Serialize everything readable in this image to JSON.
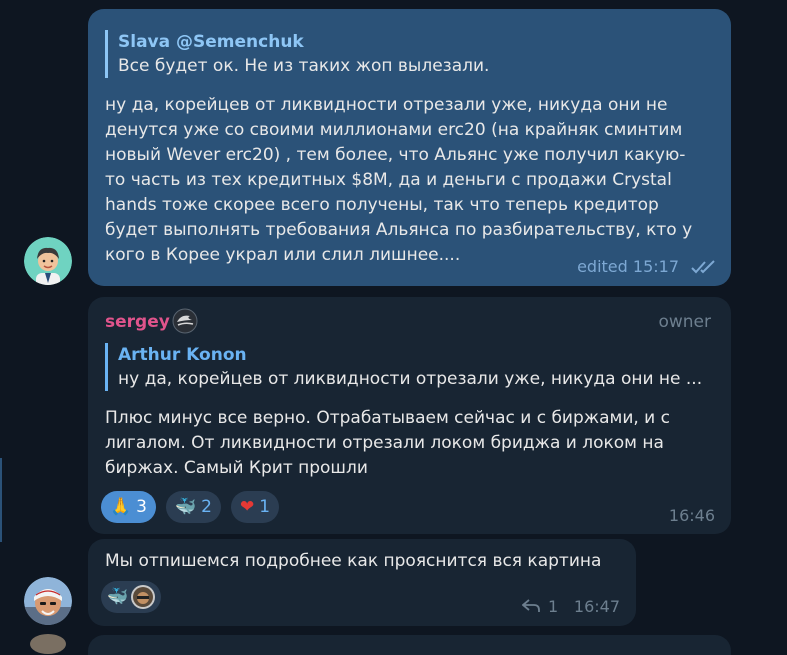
{
  "messages": [
    {
      "reply": {
        "author": "Slava @Semenchuk",
        "text": "Все будет ок. Не из таких жоп вылезали."
      },
      "lines": [
        "ну да, корейцев от ликвидности отрезали уже, никуда они не",
        "денутся уже со своими миллионами erc20 (на крайняк сминтим",
        "новый Wever erc20) , тем более, что Альянс уже получил какую-",
        "то часть из тех кредитных $8M, да и деньги   с продажи Crystal",
        "hands тоже скорее всего получены,  так что теперь кредитор",
        "будет выполнять  требования Альянса по разбирательству, кто у",
        "кого в Корее украл или слил лишнее...."
      ],
      "meta": "edited 15:17",
      "status_icon": "double-check-icon"
    },
    {
      "author": "sergey",
      "badge": "owner",
      "reply": {
        "author": "Arthur Konon",
        "text": "ну да, корейцев от ликвидности отрезали уже, никуда они не ..."
      },
      "lines": [
        "Плюс минус все верно. Отрабатываем сейчас и с биржами, и с",
        "лигалом. От ликвидности отрезали локом бриджа и локом на",
        "биржах. Самый Крит прошли"
      ],
      "reactions": [
        {
          "emoji": "🙏",
          "count": "3",
          "mine": true
        },
        {
          "emoji": "🐳",
          "count": "2",
          "mine": false
        },
        {
          "emoji": "❤",
          "count": "1",
          "mine": false
        }
      ],
      "time": "16:46"
    },
    {
      "text": "Мы отпишемся подробнее как прояснится вся картина",
      "reaction_emoji": "🐳",
      "replies_count": "1",
      "time": "16:47"
    }
  ],
  "colors": {
    "accent": "#6ab3f3",
    "author": "#e0548c",
    "background": "#0e1621"
  }
}
